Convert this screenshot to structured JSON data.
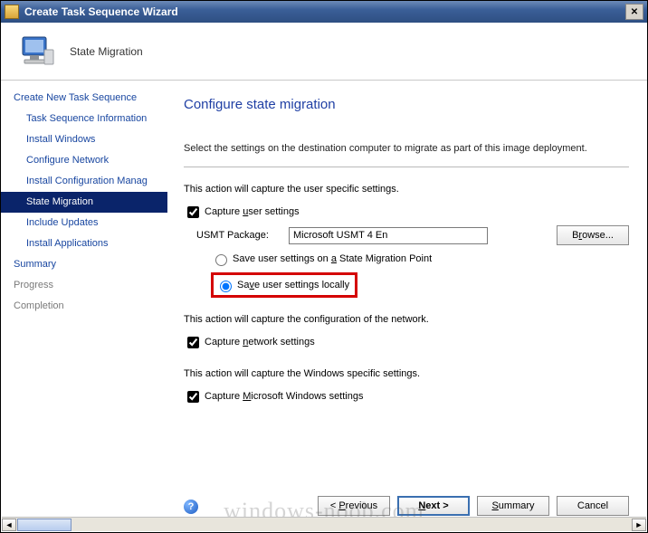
{
  "window": {
    "title": "Create Task Sequence Wizard",
    "close_glyph": "✕"
  },
  "header": {
    "subtitle": "State Migration"
  },
  "sidebar": {
    "items": [
      {
        "label": "Create New Task Sequence",
        "child": false,
        "selected": false,
        "dim": false
      },
      {
        "label": "Task Sequence Information",
        "child": true,
        "selected": false,
        "dim": false
      },
      {
        "label": "Install Windows",
        "child": true,
        "selected": false,
        "dim": false
      },
      {
        "label": "Configure Network",
        "child": true,
        "selected": false,
        "dim": false
      },
      {
        "label": "Install Configuration Manag",
        "child": true,
        "selected": false,
        "dim": false
      },
      {
        "label": "State Migration",
        "child": true,
        "selected": true,
        "dim": false
      },
      {
        "label": "Include Updates",
        "child": true,
        "selected": false,
        "dim": false
      },
      {
        "label": "Install Applications",
        "child": true,
        "selected": false,
        "dim": false
      },
      {
        "label": "Summary",
        "child": false,
        "selected": false,
        "dim": false
      },
      {
        "label": "Progress",
        "child": false,
        "selected": false,
        "dim": true
      },
      {
        "label": "Completion",
        "child": false,
        "selected": false,
        "dim": true
      }
    ]
  },
  "main": {
    "heading": "Configure state migration",
    "instruction": "Select the settings on the destination computer to migrate as part of this image deployment.",
    "section1_desc": "This action will capture the user specific settings.",
    "capture_user_label_pre": "Capture ",
    "capture_user_label_u": "u",
    "capture_user_label_post": "ser settings",
    "pkg_label": "USMT Package:",
    "pkg_value": "Microsoft USMT 4 En",
    "browse_label_pre": "B",
    "browse_label_u": "r",
    "browse_label_post": "owse...",
    "opt_smp_pre": "Save user settings on ",
    "opt_smp_u": "a",
    "opt_smp_post": " State Migration Point",
    "opt_local_pre": "Sa",
    "opt_local_u": "v",
    "opt_local_post": "e user settings locally",
    "section2_desc": "This action will capture the configuration of the network.",
    "cap_net_pre": "Capture ",
    "cap_net_u": "n",
    "cap_net_post": "etwork settings",
    "section3_desc": "This action will capture the Windows specific settings.",
    "cap_win_pre": "Capture ",
    "cap_win_u": "M",
    "cap_win_post": "icrosoft Windows settings"
  },
  "buttons": {
    "prev_pre": "< ",
    "prev_u": "P",
    "prev_post": "revious",
    "next_pre": "",
    "next_u": "N",
    "next_post": "ext >",
    "summary_pre": "",
    "summary_u": "S",
    "summary_post": "ummary",
    "cancel": "Cancel"
  },
  "help_glyph": "?",
  "watermark": "windows-noob.com",
  "scroll": {
    "left": "◄",
    "right": "►"
  }
}
